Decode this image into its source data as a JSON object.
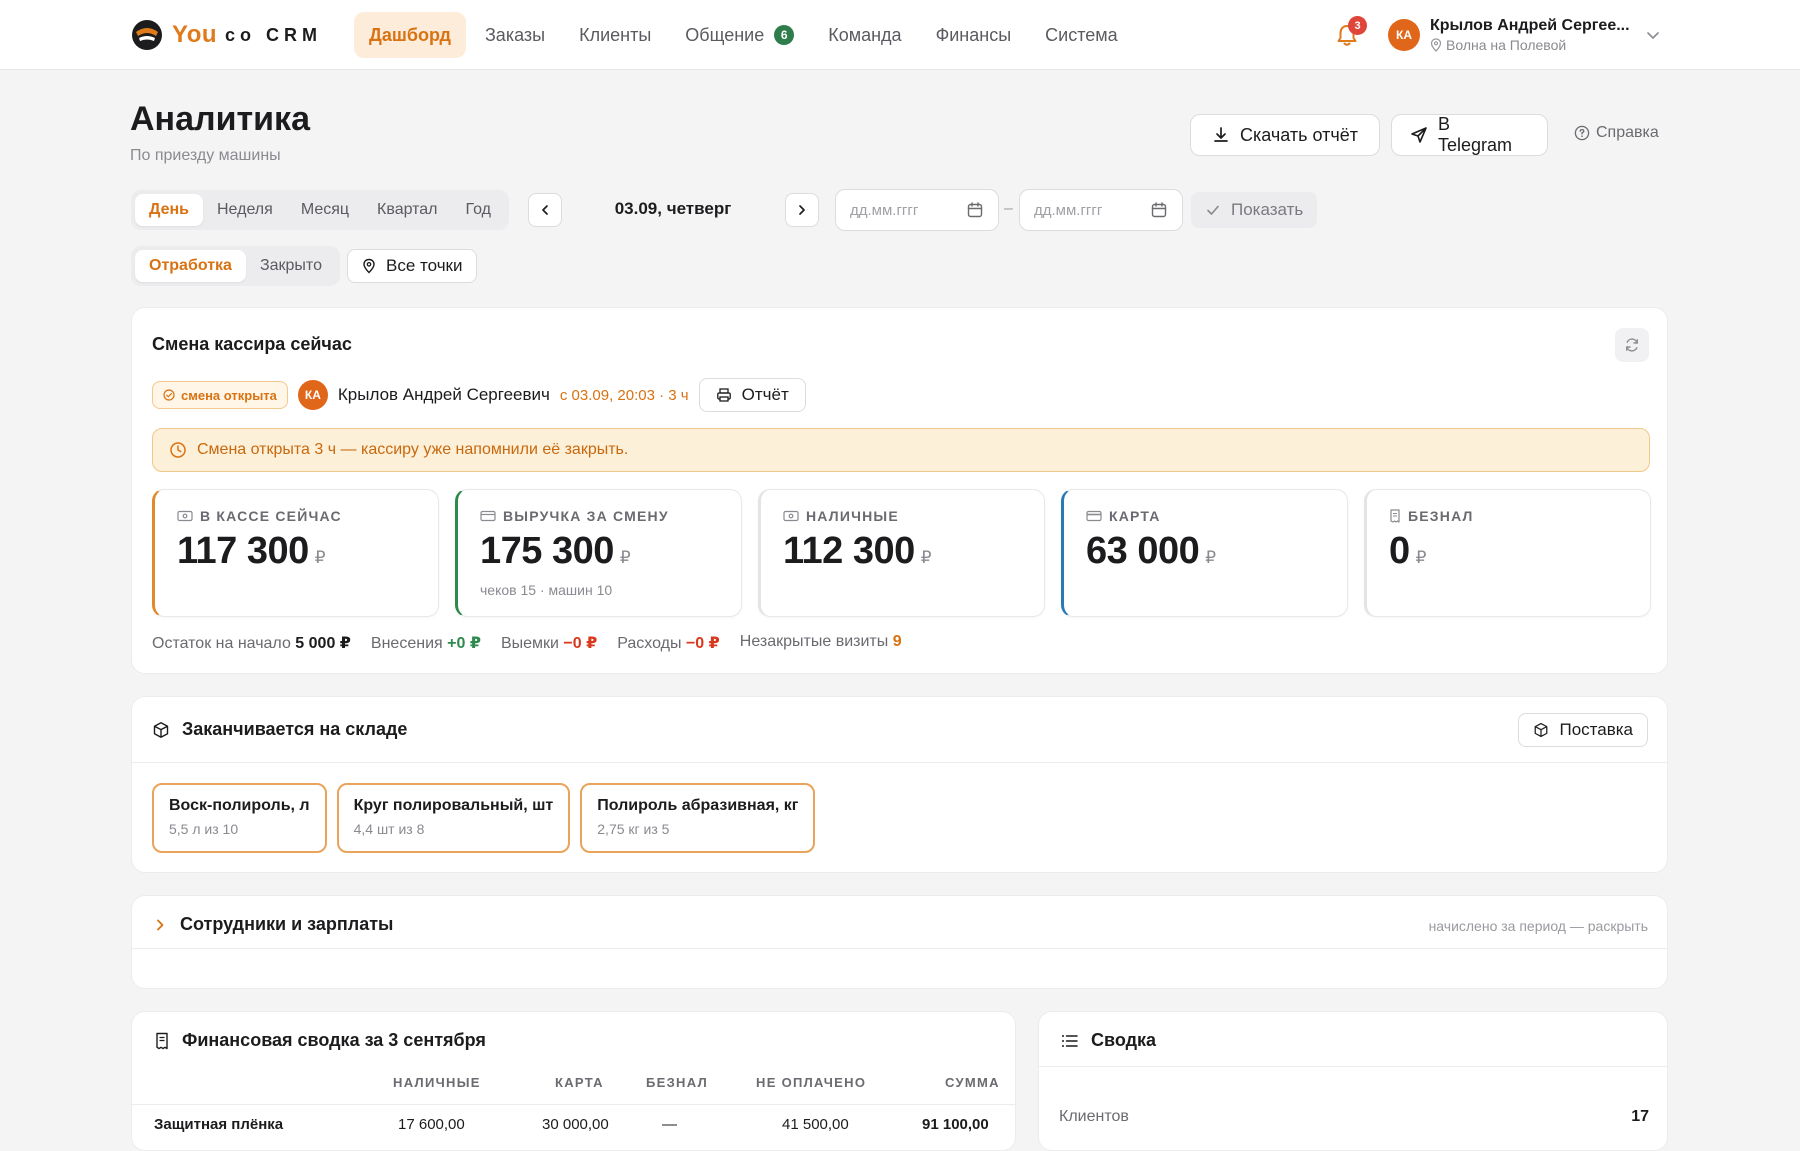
{
  "brand": {
    "you": "You",
    "rest": "co CRM"
  },
  "nav": {
    "items": [
      {
        "label": "Дашборд"
      },
      {
        "label": "Заказы"
      },
      {
        "label": "Клиенты"
      },
      {
        "label": "Общение",
        "badge": "6"
      },
      {
        "label": "Команда"
      },
      {
        "label": "Финансы"
      },
      {
        "label": "Система"
      }
    ],
    "notifications_count": "3"
  },
  "user": {
    "initials": "КА",
    "name": "Крылов Андрей Сергее...",
    "location": "Волна на Полевой"
  },
  "page": {
    "title": "Аналитика",
    "subtitle": "По приезду машины"
  },
  "actions": {
    "download": "Скачать отчёт",
    "telegram": "В Telegram",
    "help": "Справка"
  },
  "period": {
    "tabs": [
      "День",
      "Неделя",
      "Месяц",
      "Квартал",
      "Год"
    ],
    "active": "День",
    "current_date": "03.09, четверг",
    "date_from_placeholder": "дд.мм.гггг",
    "date_to_placeholder": "дд.мм.гггг",
    "show_label": "Показать"
  },
  "status_filter": {
    "tabs": [
      "Отработка",
      "Закрыто"
    ],
    "active": "Отработка",
    "points_label": "Все точки"
  },
  "shift": {
    "title": "Смена кассира сейчас",
    "badge": "смена открыта",
    "cashier_initials": "КА",
    "cashier_name": "Крылов Андрей Сергеевич",
    "since": "с 03.09, 20:03 · 3 ч",
    "report_label": "Отчёт",
    "alert": "Смена открыта 3 ч — кассиру уже напомнили её закрыть.",
    "metrics": [
      {
        "label": "В КАССЕ СЕЙЧАС",
        "value": "117 300",
        "currency": "₽",
        "note": "",
        "accent": "#e08a2a"
      },
      {
        "label": "ВЫРУЧКА ЗА СМЕНУ",
        "value": "175 300",
        "currency": "₽",
        "note": "чеков 15 · машин 10",
        "accent": "#2e8a4c"
      },
      {
        "label": "НАЛИЧНЫЕ",
        "value": "112 300",
        "currency": "₽",
        "note": "",
        "accent": "#e4e4e6"
      },
      {
        "label": "КАРТА",
        "value": "63 000",
        "currency": "₽",
        "note": "",
        "accent": "#2a7ab8"
      },
      {
        "label": "БЕЗНАЛ",
        "value": "0",
        "currency": "₽",
        "note": "",
        "accent": "#e4e4e6"
      }
    ],
    "summary": {
      "start_label": "Остаток на начало",
      "start_value": "5 000 ₽",
      "deposits_label": "Внесения",
      "deposits_value": "+0 ₽",
      "withdrawals_label": "Выемки",
      "withdrawals_value": "−0 ₽",
      "expenses_label": "Расходы",
      "expenses_value": "−0 ₽",
      "unclosed_label": "Незакрытые визиты",
      "unclosed_value": "9"
    }
  },
  "stock": {
    "title": "Заканчивается на складе",
    "supply_label": "Поставка",
    "items": [
      {
        "name": "Воск-полироль, л",
        "qty": "5,5 л из 10"
      },
      {
        "name": "Круг полировальный, шт",
        "qty": "4,4 шт из 8"
      },
      {
        "name": "Полироль абразивная, кг",
        "qty": "2,75 кг из 5"
      }
    ]
  },
  "staff": {
    "title": "Сотрудники и зарплаты",
    "hint": "начислено за период — раскрыть"
  },
  "finance": {
    "title": "Финансовая сводка за 3 сентября",
    "columns": [
      "НАЛИЧНЫЕ",
      "КАРТА",
      "БЕЗНАЛ",
      "НЕ ОПЛАЧЕНО",
      "СУММА"
    ],
    "rows": [
      {
        "name": "Защитная плёнка",
        "cash": "17 600,00",
        "card": "30 000,00",
        "noncash": "—",
        "unpaid": "41 500,00",
        "total": "91 100,00"
      }
    ]
  },
  "summary_card": {
    "title": "Сводка",
    "rows": [
      {
        "label": "Клиентов",
        "value": "17"
      }
    ]
  },
  "colors": {
    "accent": "#d97212",
    "positive": "#2e8a4c",
    "negative": "#d9381e"
  }
}
